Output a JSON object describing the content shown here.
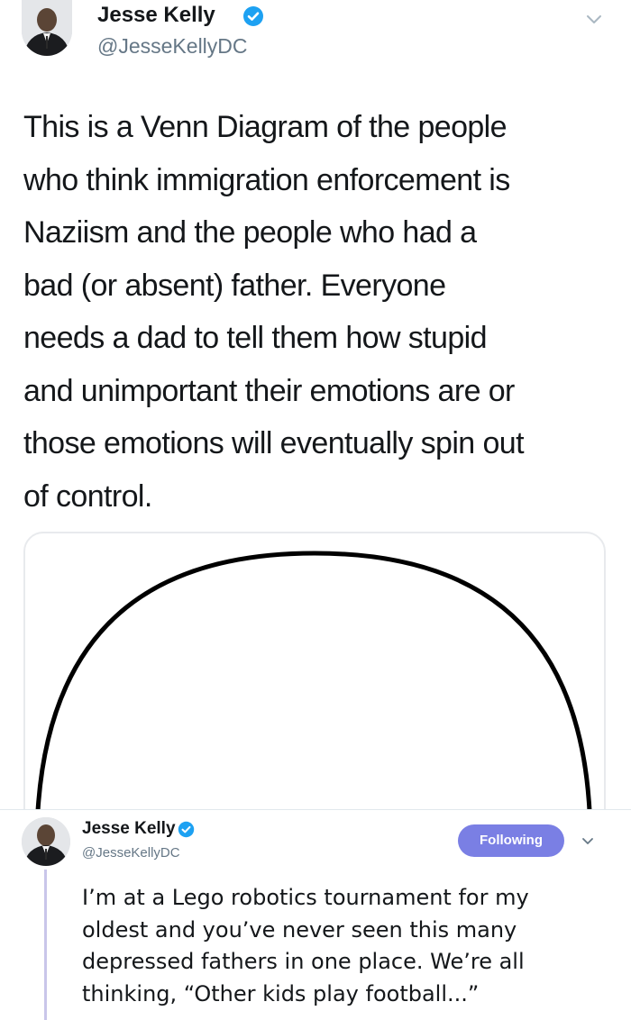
{
  "tweet_1": {
    "author_name": "Jesse Kelly",
    "author_handle": "@JesseKellyDC",
    "verified_icon": "verified-badge-icon",
    "menu_icon": "chevron-down-icon",
    "text_lines": [
      "This is a Venn Diagram of the people",
      "who think immigration enforcement is",
      "Naziism and the people who had a",
      "bad (or absent) father. Everyone",
      "needs a dad to tell them how stupid",
      "and unimportant their emotions are or",
      "those emotions will eventually spin out",
      "of control."
    ],
    "media": "venn-diagram-single-circle"
  },
  "tweet_2": {
    "author_name": "Jesse Kelly",
    "author_handle": "@JesseKellyDC",
    "verified_icon": "verified-badge-icon",
    "follow_label": "Following",
    "menu_icon": "chevron-down-icon",
    "text_lines": [
      "I’m at a Lego robotics tournament for my",
      "oldest and you’ve never seen this many",
      "depressed fathers in one place. We’re all",
      "thinking, “Other kids play football...”"
    ]
  },
  "colors": {
    "verified": "#1da1f2",
    "follow_button": "#7a7fe4",
    "thread_line": "#c9c6ea",
    "handle": "#657786",
    "text": "#14171a"
  }
}
